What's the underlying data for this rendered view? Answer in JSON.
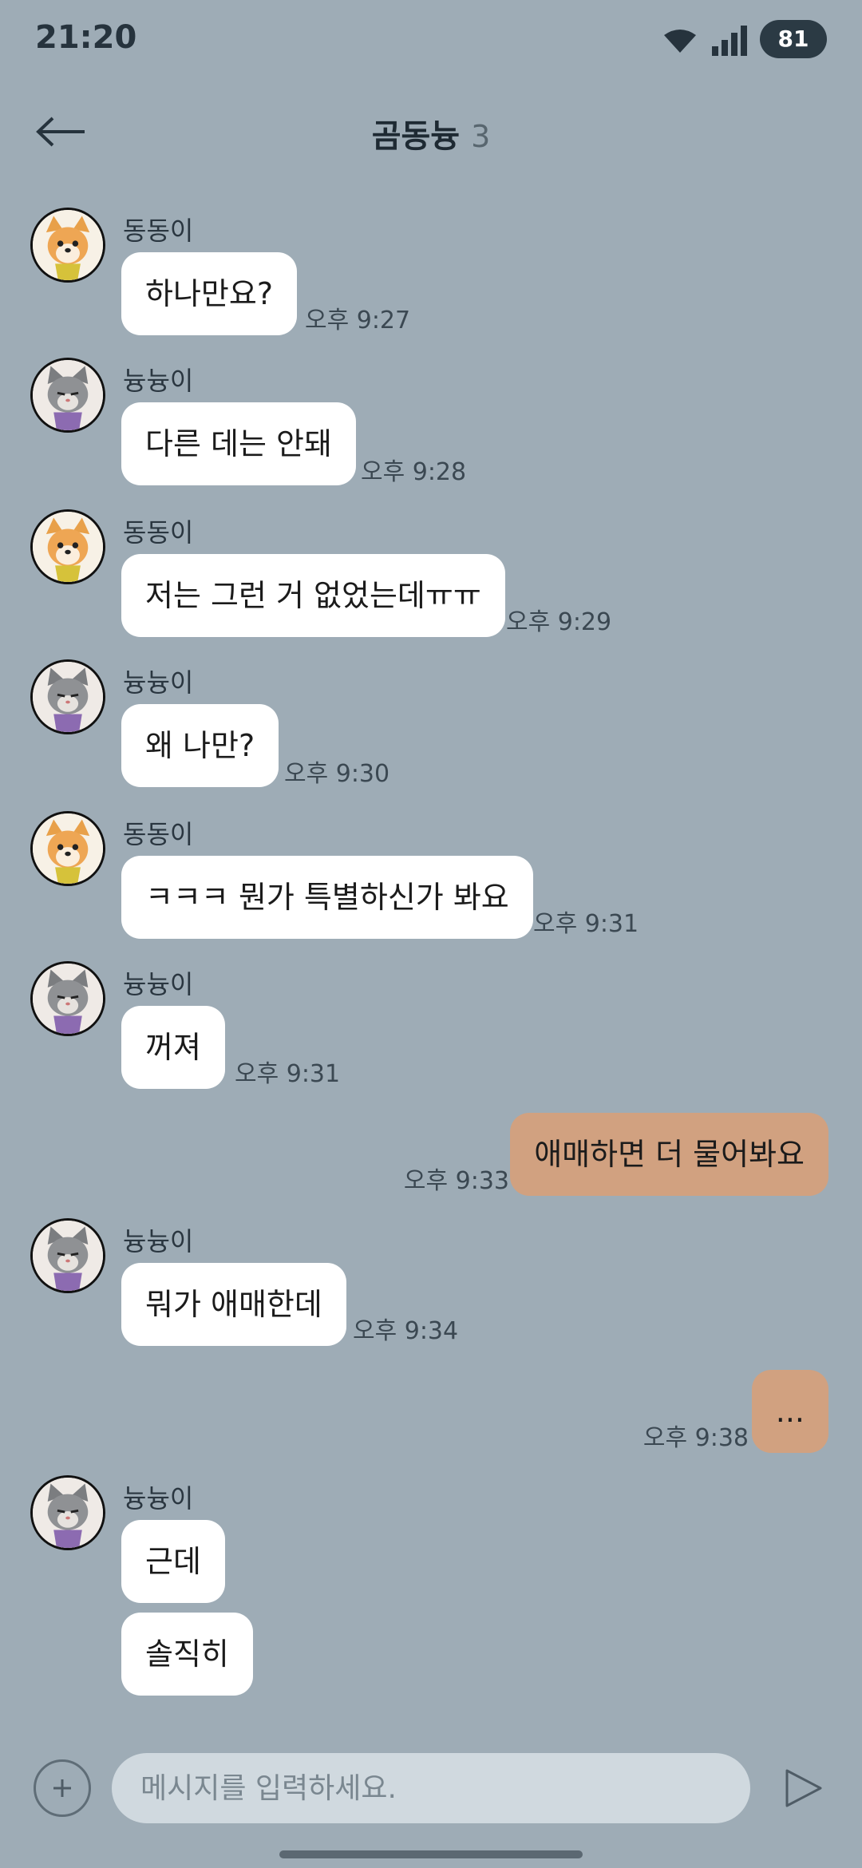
{
  "status_bar": {
    "time": "21:20",
    "battery": "81",
    "icons": [
      "wifi-icon",
      "signal-icon"
    ]
  },
  "header": {
    "title": "곰동늉",
    "member_count": "3",
    "back_icon": "back-arrow-icon"
  },
  "messages": [
    {
      "sender": "동동이",
      "text": "하나만요?",
      "time": "오후 9:27",
      "avatar": "dog"
    },
    {
      "sender": "늉늉이",
      "text": "다른 데는 안돼",
      "time": "오후 9:28",
      "avatar": "cat"
    },
    {
      "sender": "동동이",
      "text": "저는 그런 거 없었는데ㅠㅠ",
      "time": "오후 9:29",
      "avatar": "dog"
    },
    {
      "sender": "늉늉이",
      "text": "왜 나만?",
      "time": "오후 9:30",
      "avatar": "cat"
    },
    {
      "sender": "동동이",
      "text": "ㅋㅋㅋ 뭔가 특별하신가 봐요",
      "time": "오후 9:31",
      "avatar": "dog"
    },
    {
      "sender": "늉늉이",
      "text": "꺼져",
      "time": "오후 9:31",
      "avatar": "cat"
    },
    {
      "sender": "me",
      "text": "애매하면 더 물어봐요",
      "time": "오후 9:33"
    },
    {
      "sender": "늉늉이",
      "text": "뭐가 애매한데",
      "time": "오후 9:34",
      "avatar": "cat"
    },
    {
      "sender": "me",
      "text": "...",
      "time": "오후 9:38"
    },
    {
      "sender": "늉늉이",
      "text": "근데",
      "avatar": "cat"
    },
    {
      "sender": "늉늉이",
      "text": "솔직히"
    }
  ],
  "composer": {
    "placeholder": "메시지를 입력하세요.",
    "plus_icon": "plus-icon",
    "send_icon": "send-icon"
  },
  "colors": {
    "background": "#9eacb6",
    "incoming_bubble": "#ffffff",
    "outgoing_bubble": "#d1a180",
    "input": "#d0d9df"
  }
}
